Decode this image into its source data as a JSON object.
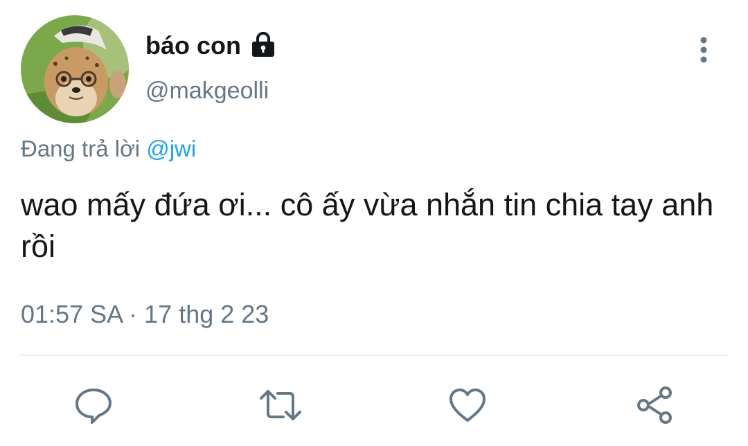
{
  "tweet": {
    "display_name": "báo con",
    "handle": "@makgeolli",
    "protected_icon": "lock-icon",
    "reply_prefix": "Đang trả lời",
    "reply_mention": "@jwi",
    "text": "wao mấy đứa ơi... cô ấy vừa nhắn tin chia tay anh rồi",
    "time": "01:57 SA",
    "separator": "·",
    "date": "17 thg 2 23"
  },
  "actions": [
    {
      "name": "reply",
      "icon": "comment-icon"
    },
    {
      "name": "retweet",
      "icon": "retweet-icon"
    },
    {
      "name": "like",
      "icon": "heart-icon"
    },
    {
      "name": "share",
      "icon": "share-icon"
    }
  ],
  "colors": {
    "text_primary": "#14171a",
    "text_secondary": "#657786",
    "accent": "#1da1f2",
    "divider": "#e6ecf0"
  }
}
